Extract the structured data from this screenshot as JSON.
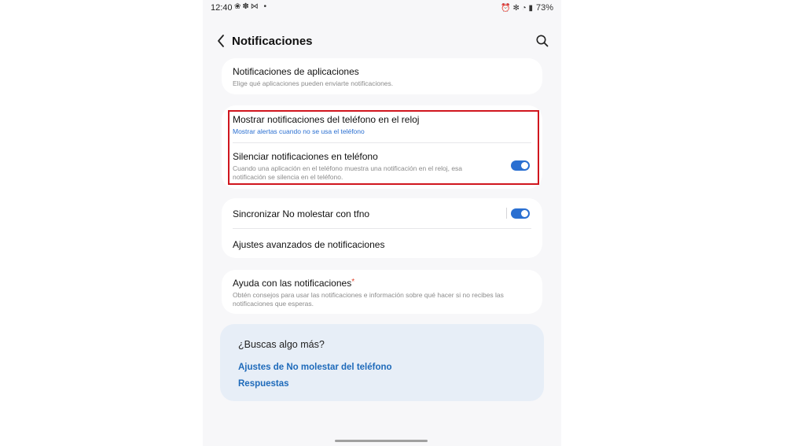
{
  "status": {
    "time": "12:40",
    "left_icons": "❀✽⋈ •",
    "right_icons": "⏰ ✻ ◔ ▮",
    "battery": "73%"
  },
  "appbar": {
    "title": "Notificaciones"
  },
  "cards": {
    "app_notifications": {
      "title": "Notificaciones de aplicaciones",
      "subtitle": "Elige qué aplicaciones pueden enviarte notificaciones."
    },
    "show_on_watch": {
      "title": "Mostrar notificaciones del teléfono en el reloj",
      "subtitle": "Mostrar alertas cuando no se usa el teléfono"
    },
    "mute_on_phone": {
      "title": "Silenciar notificaciones en teléfono",
      "subtitle_line1": "Cuando una aplicación en el teléfono muestra una notificación en el reloj, esa",
      "subtitle_line2": "notificación se silencia en el teléfono.",
      "enabled": true
    },
    "sync_dnd": {
      "title": "Sincronizar No molestar con tfno",
      "enabled": true
    },
    "advanced": {
      "title": "Ajustes avanzados de notificaciones"
    },
    "help": {
      "title": "Ayuda con las notificaciones",
      "badge": "*",
      "subtitle_line1": "Obtén consejos para usar las notificaciones e información sobre qué hacer si no recibes las",
      "subtitle_line2": "notificaciones que esperas."
    }
  },
  "more": {
    "title": "¿Buscas algo más?",
    "links": [
      "Ajustes de No molestar del teléfono",
      "Respuestas"
    ]
  },
  "colors": {
    "accent": "#2a6fd1",
    "highlight_border": "#d0161e",
    "link": "#1e6aba"
  }
}
